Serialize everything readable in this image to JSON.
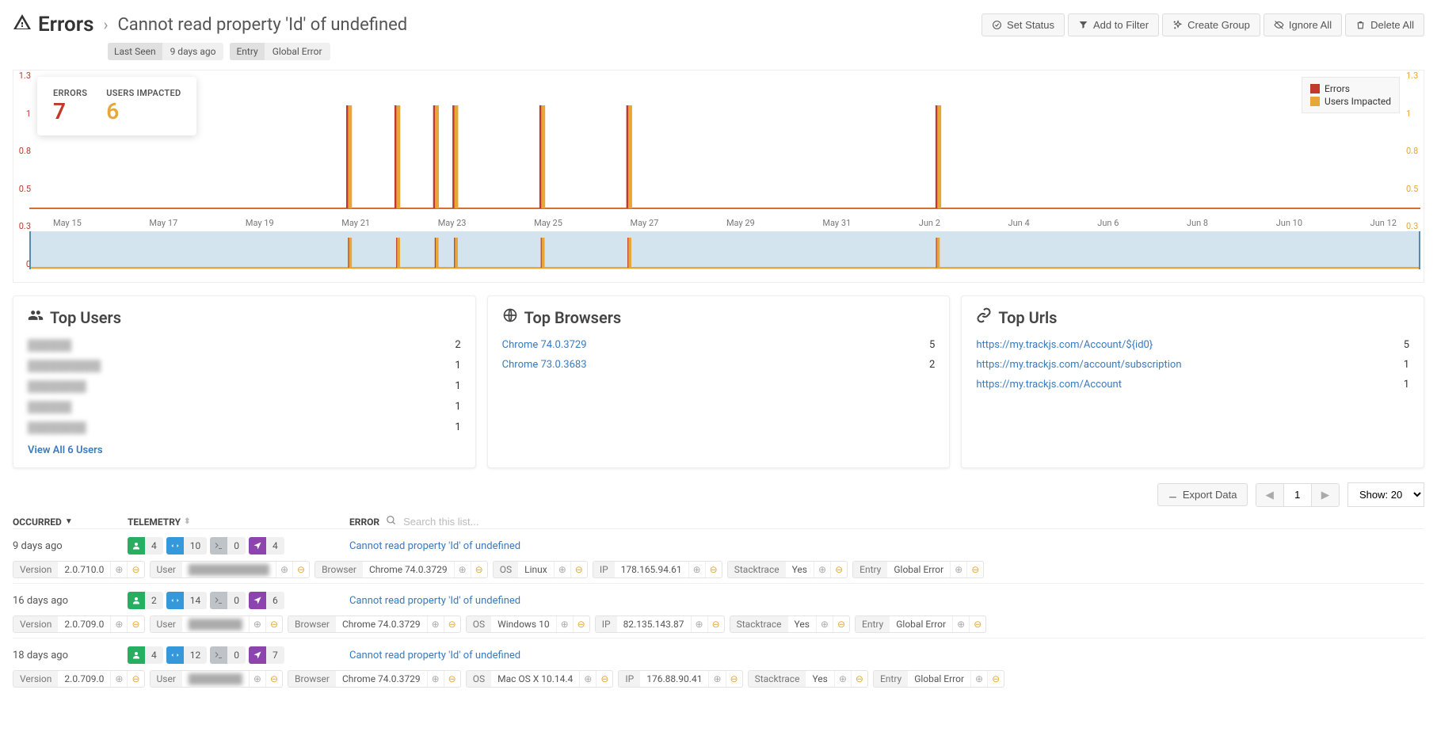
{
  "header": {
    "title": "Errors",
    "error_name": "Cannot read property 'Id' of undefined",
    "actions": {
      "set_status": "Set Status",
      "add_to_filter": "Add to Filter",
      "create_group": "Create Group",
      "ignore_all": "Ignore All",
      "delete_all": "Delete All"
    },
    "sub_tags": [
      {
        "label": "Last Seen",
        "value": "9 days ago"
      },
      {
        "label": "Entry",
        "value": "Global Error"
      }
    ]
  },
  "summary": {
    "errors_label": "ERRORS",
    "errors_value": "7",
    "users_label": "USERS IMPACTED",
    "users_value": "6"
  },
  "chart_legend": {
    "errors": "Errors",
    "users": "Users Impacted"
  },
  "chart_data": {
    "type": "bar",
    "y_left_label": "Errors",
    "y_right_label": "Users Impacted",
    "ylim": [
      0,
      1.3
    ],
    "y_ticks": [
      "1.3",
      "1",
      "0.8",
      "0.5",
      "0.3",
      "0"
    ],
    "x_ticks": [
      "May 15",
      "May 17",
      "May 19",
      "May 21",
      "May 23",
      "May 25",
      "May 27",
      "May 29",
      "May 31",
      "Jun 2",
      "Jun 4",
      "Jun 6",
      "Jun 8",
      "Jun 10",
      "Jun 12"
    ],
    "series": [
      {
        "name": "Errors",
        "color": "#c0392b"
      },
      {
        "name": "Users Impacted",
        "color": "#e6a737"
      }
    ],
    "events": [
      {
        "date": "May 21",
        "errors": 1,
        "users": 1
      },
      {
        "date": "May 22",
        "errors": 1,
        "users": 1
      },
      {
        "date": "May 23",
        "errors": 1,
        "users": 1
      },
      {
        "date": "May 23b",
        "errors": 1,
        "users": 1
      },
      {
        "date": "May 25",
        "errors": 1,
        "users": 1
      },
      {
        "date": "May 27",
        "errors": 1,
        "users": 1
      },
      {
        "date": "Jun 3",
        "errors": 1,
        "users": 1
      }
    ]
  },
  "panels": {
    "top_users": {
      "title": "Top Users",
      "rows": [
        {
          "name": "██████",
          "count": "2"
        },
        {
          "name": "██████████",
          "count": "1"
        },
        {
          "name": "████████",
          "count": "1"
        },
        {
          "name": "██████",
          "count": "1"
        },
        {
          "name": "████████",
          "count": "1"
        }
      ],
      "view_all": "View All 6 Users"
    },
    "top_browsers": {
      "title": "Top Browsers",
      "rows": [
        {
          "name": "Chrome 74.0.3729",
          "count": "5"
        },
        {
          "name": "Chrome 73.0.3683",
          "count": "2"
        }
      ]
    },
    "top_urls": {
      "title": "Top Urls",
      "rows": [
        {
          "name": "https://my.trackjs.com/Account/${id0}",
          "count": "5"
        },
        {
          "name": "https://my.trackjs.com/account/subscription",
          "count": "1"
        },
        {
          "name": "https://my.trackjs.com/Account",
          "count": "1"
        }
      ]
    }
  },
  "table": {
    "export": "Export Data",
    "page_num": "1",
    "show_label": "Show: 20",
    "headers": {
      "occurred": "OCCURRED",
      "telemetry": "TELEMETRY",
      "error": "ERROR",
      "search_placeholder": "Search this list..."
    },
    "rows": [
      {
        "occurred": "9 days ago",
        "badges": {
          "user": "4",
          "network": "10",
          "console": "0",
          "nav": "4"
        },
        "error": "Cannot read property 'Id' of undefined",
        "tags": [
          {
            "label": "Version",
            "value": "2.0.710.0"
          },
          {
            "label": "User",
            "value": "████████████",
            "blurred": true
          },
          {
            "label": "Browser",
            "value": "Chrome 74.0.3729"
          },
          {
            "label": "OS",
            "value": "Linux"
          },
          {
            "label": "IP",
            "value": "178.165.94.61"
          },
          {
            "label": "Stacktrace",
            "value": "Yes"
          },
          {
            "label": "Entry",
            "value": "Global Error"
          }
        ]
      },
      {
        "occurred": "16 days ago",
        "badges": {
          "user": "2",
          "network": "14",
          "console": "0",
          "nav": "6"
        },
        "error": "Cannot read property 'Id' of undefined",
        "tags": [
          {
            "label": "Version",
            "value": "2.0.709.0"
          },
          {
            "label": "User",
            "value": "████████",
            "blurred": true
          },
          {
            "label": "Browser",
            "value": "Chrome 74.0.3729"
          },
          {
            "label": "OS",
            "value": "Windows 10"
          },
          {
            "label": "IP",
            "value": "82.135.143.87"
          },
          {
            "label": "Stacktrace",
            "value": "Yes"
          },
          {
            "label": "Entry",
            "value": "Global Error"
          }
        ]
      },
      {
        "occurred": "18 days ago",
        "badges": {
          "user": "4",
          "network": "12",
          "console": "0",
          "nav": "7"
        },
        "error": "Cannot read property 'Id' of undefined",
        "tags": [
          {
            "label": "Version",
            "value": "2.0.709.0"
          },
          {
            "label": "User",
            "value": "████████",
            "blurred": true
          },
          {
            "label": "Browser",
            "value": "Chrome 74.0.3729"
          },
          {
            "label": "OS",
            "value": "Mac OS X 10.14.4"
          },
          {
            "label": "IP",
            "value": "176.88.90.41"
          },
          {
            "label": "Stacktrace",
            "value": "Yes"
          },
          {
            "label": "Entry",
            "value": "Global Error"
          }
        ]
      }
    ]
  }
}
